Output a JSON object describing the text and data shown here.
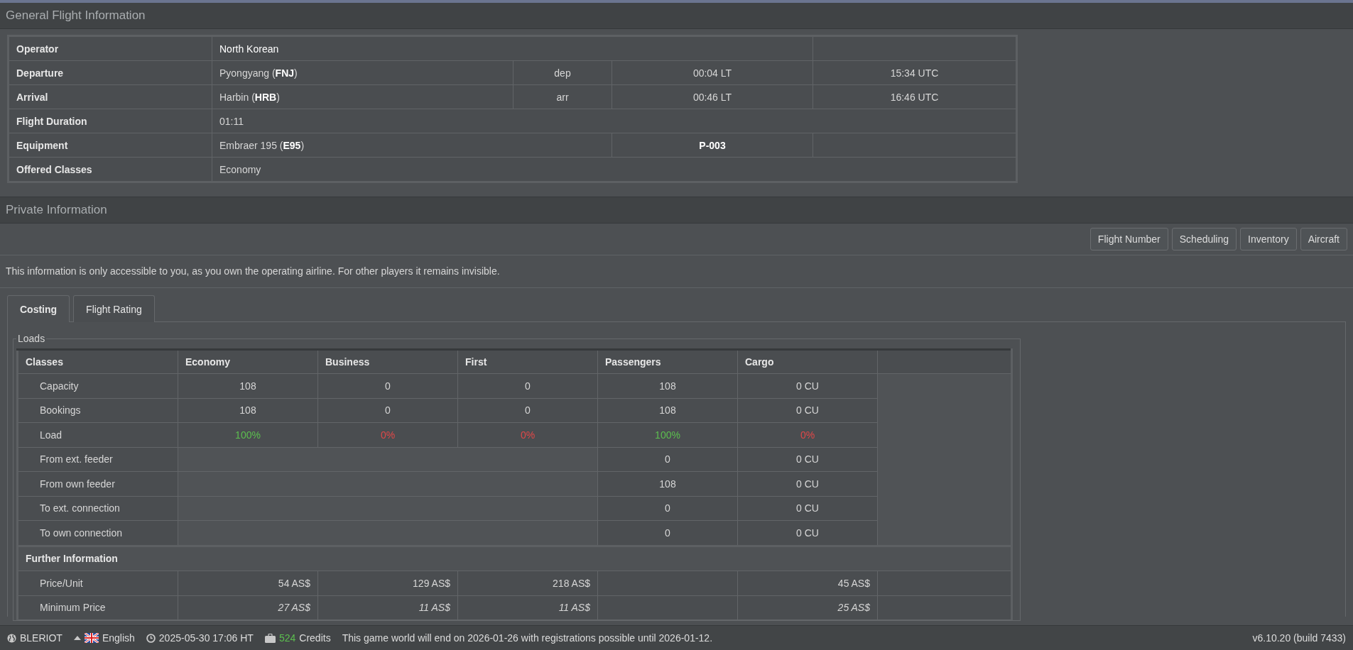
{
  "general": {
    "title": "General Flight Information",
    "rows": [
      {
        "kind": "operator",
        "label": "Operator",
        "value": "North Korean"
      },
      {
        "kind": "leg",
        "label": "Departure",
        "place": "Pyongyang (**FNJ**)",
        "direction": "dep",
        "local": "00:04 LT",
        "utc": "15:34 UTC"
      },
      {
        "kind": "leg",
        "label": "Arrival",
        "place": "Harbin (**HRB**)",
        "direction": "arr",
        "local": "00:46 LT",
        "utc": "16:46 UTC"
      },
      {
        "kind": "text",
        "label": "Flight Duration",
        "value": "01:11"
      },
      {
        "kind": "equipment",
        "label": "Equipment",
        "value": "Embraer 195 (**E95**)",
        "registration": "P-003"
      },
      {
        "kind": "text",
        "label": "Offered Classes",
        "value": "Economy"
      }
    ]
  },
  "private": {
    "title": "Private Information",
    "buttons": [
      "Flight Number",
      "Scheduling",
      "Inventory",
      "Aircraft"
    ],
    "notice": "This information is only accessible to you, as you own the operating airline. For other players it remains invisible.",
    "tabs": [
      {
        "label": "Costing",
        "selected": true
      },
      {
        "label": "Flight Rating",
        "selected": false
      }
    ],
    "loads": {
      "legend": "Loads",
      "columns": [
        "Classes",
        "Economy",
        "Business",
        "First",
        "Passengers",
        "Cargo"
      ],
      "rows": [
        {
          "kind": "values",
          "label": "Capacity",
          "values": [
            "108",
            "0",
            "0",
            "108",
            "0 CU"
          ]
        },
        {
          "kind": "values",
          "label": "Bookings",
          "values": [
            "108",
            "0",
            "0",
            "108",
            "0 CU"
          ]
        },
        {
          "kind": "load",
          "label": "Load",
          "values": [
            {
              "text": "100%",
              "color": "#5cbf4f"
            },
            {
              "text": "0%",
              "color": "#e04848"
            },
            {
              "text": "0%",
              "color": "#e04848"
            },
            {
              "text": "100%",
              "color": "#5cbf4f"
            },
            {
              "text": "0%",
              "color": "#e04848"
            }
          ]
        },
        {
          "kind": "transfer",
          "label": "From ext. feeder",
          "values": [
            "0",
            "0 CU"
          ]
        },
        {
          "kind": "transfer",
          "label": "From own feeder",
          "values": [
            "108",
            "0 CU"
          ]
        },
        {
          "kind": "transfer",
          "label": "To ext. connection",
          "values": [
            "0",
            "0 CU"
          ]
        },
        {
          "kind": "transfer",
          "label": "To own connection",
          "values": [
            "0",
            "0 CU"
          ]
        }
      ],
      "further_title": "Further Information",
      "further_rows": [
        {
          "kind": "price",
          "label": "Price/Unit",
          "economy": "54 AS$",
          "business": "129 AS$",
          "first": "218 AS$",
          "cargo": "45 AS$"
        },
        {
          "kind": "minimum",
          "label": "Minimum Price",
          "economy": "27 AS$",
          "business": "11 AS$",
          "first": "11 AS$",
          "cargo": "25 AS$"
        }
      ]
    }
  },
  "status_bar": {
    "world": "BLERIOT",
    "language": "English",
    "time": "2025-05-30 17:06 HT",
    "credits_amount": "524",
    "credits_label": "Credits",
    "message": "This game world will end on 2026-01-26 with registrations possible until 2026-01-12.",
    "version": "v6.10.20 (build 7433)"
  }
}
